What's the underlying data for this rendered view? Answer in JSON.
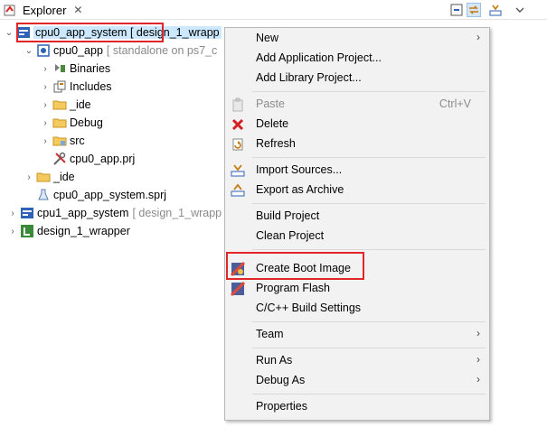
{
  "explorer": {
    "tab_title": "Explorer",
    "close_glyph": "✕",
    "toolbar": [
      "collapse-all-icon",
      "link-with-editor-icon",
      "import-icon",
      "view-menu-icon"
    ]
  },
  "tree": [
    {
      "label": "cpu0_app_system",
      "suffix": "[ design_1_wrapp"
    },
    {
      "label": "cpu0_app",
      "suffix": "[ standalone on ps7_c"
    },
    {
      "label": "Binaries",
      "suffix": ""
    },
    {
      "label": "Includes",
      "suffix": ""
    },
    {
      "label": "_ide",
      "suffix": ""
    },
    {
      "label": "Debug",
      "suffix": ""
    },
    {
      "label": "src",
      "suffix": ""
    },
    {
      "label": "cpu0_app.prj",
      "suffix": ""
    },
    {
      "label": "_ide",
      "suffix": ""
    },
    {
      "label": "cpu0_app_system.sprj",
      "suffix": ""
    },
    {
      "label": "cpu1_app_system",
      "suffix": "[ design_1_wrapp"
    },
    {
      "label": "design_1_wrapper",
      "suffix": ""
    }
  ],
  "menu": {
    "new": "New",
    "add_application": "Add Application Project...",
    "add_library": "Add Library Project...",
    "paste": "Paste",
    "paste_shortcut": "Ctrl+V",
    "delete": "Delete",
    "refresh": "Refresh",
    "import_sources": "Import Sources...",
    "export_archive": "Export as Archive",
    "build_project": "Build Project",
    "clean_project": "Clean Project",
    "create_boot_image": "Create Boot Image",
    "program_flash": "Program Flash",
    "build_settings": "C/C++ Build Settings",
    "team": "Team",
    "run_as": "Run As",
    "debug_as": "Debug As",
    "properties": "Properties",
    "submenu_arrow": "›"
  },
  "colors": {
    "highlight_border": "#e0262b",
    "selection_bg": "#cce8ff",
    "menu_bg": "#f2f2f2"
  }
}
